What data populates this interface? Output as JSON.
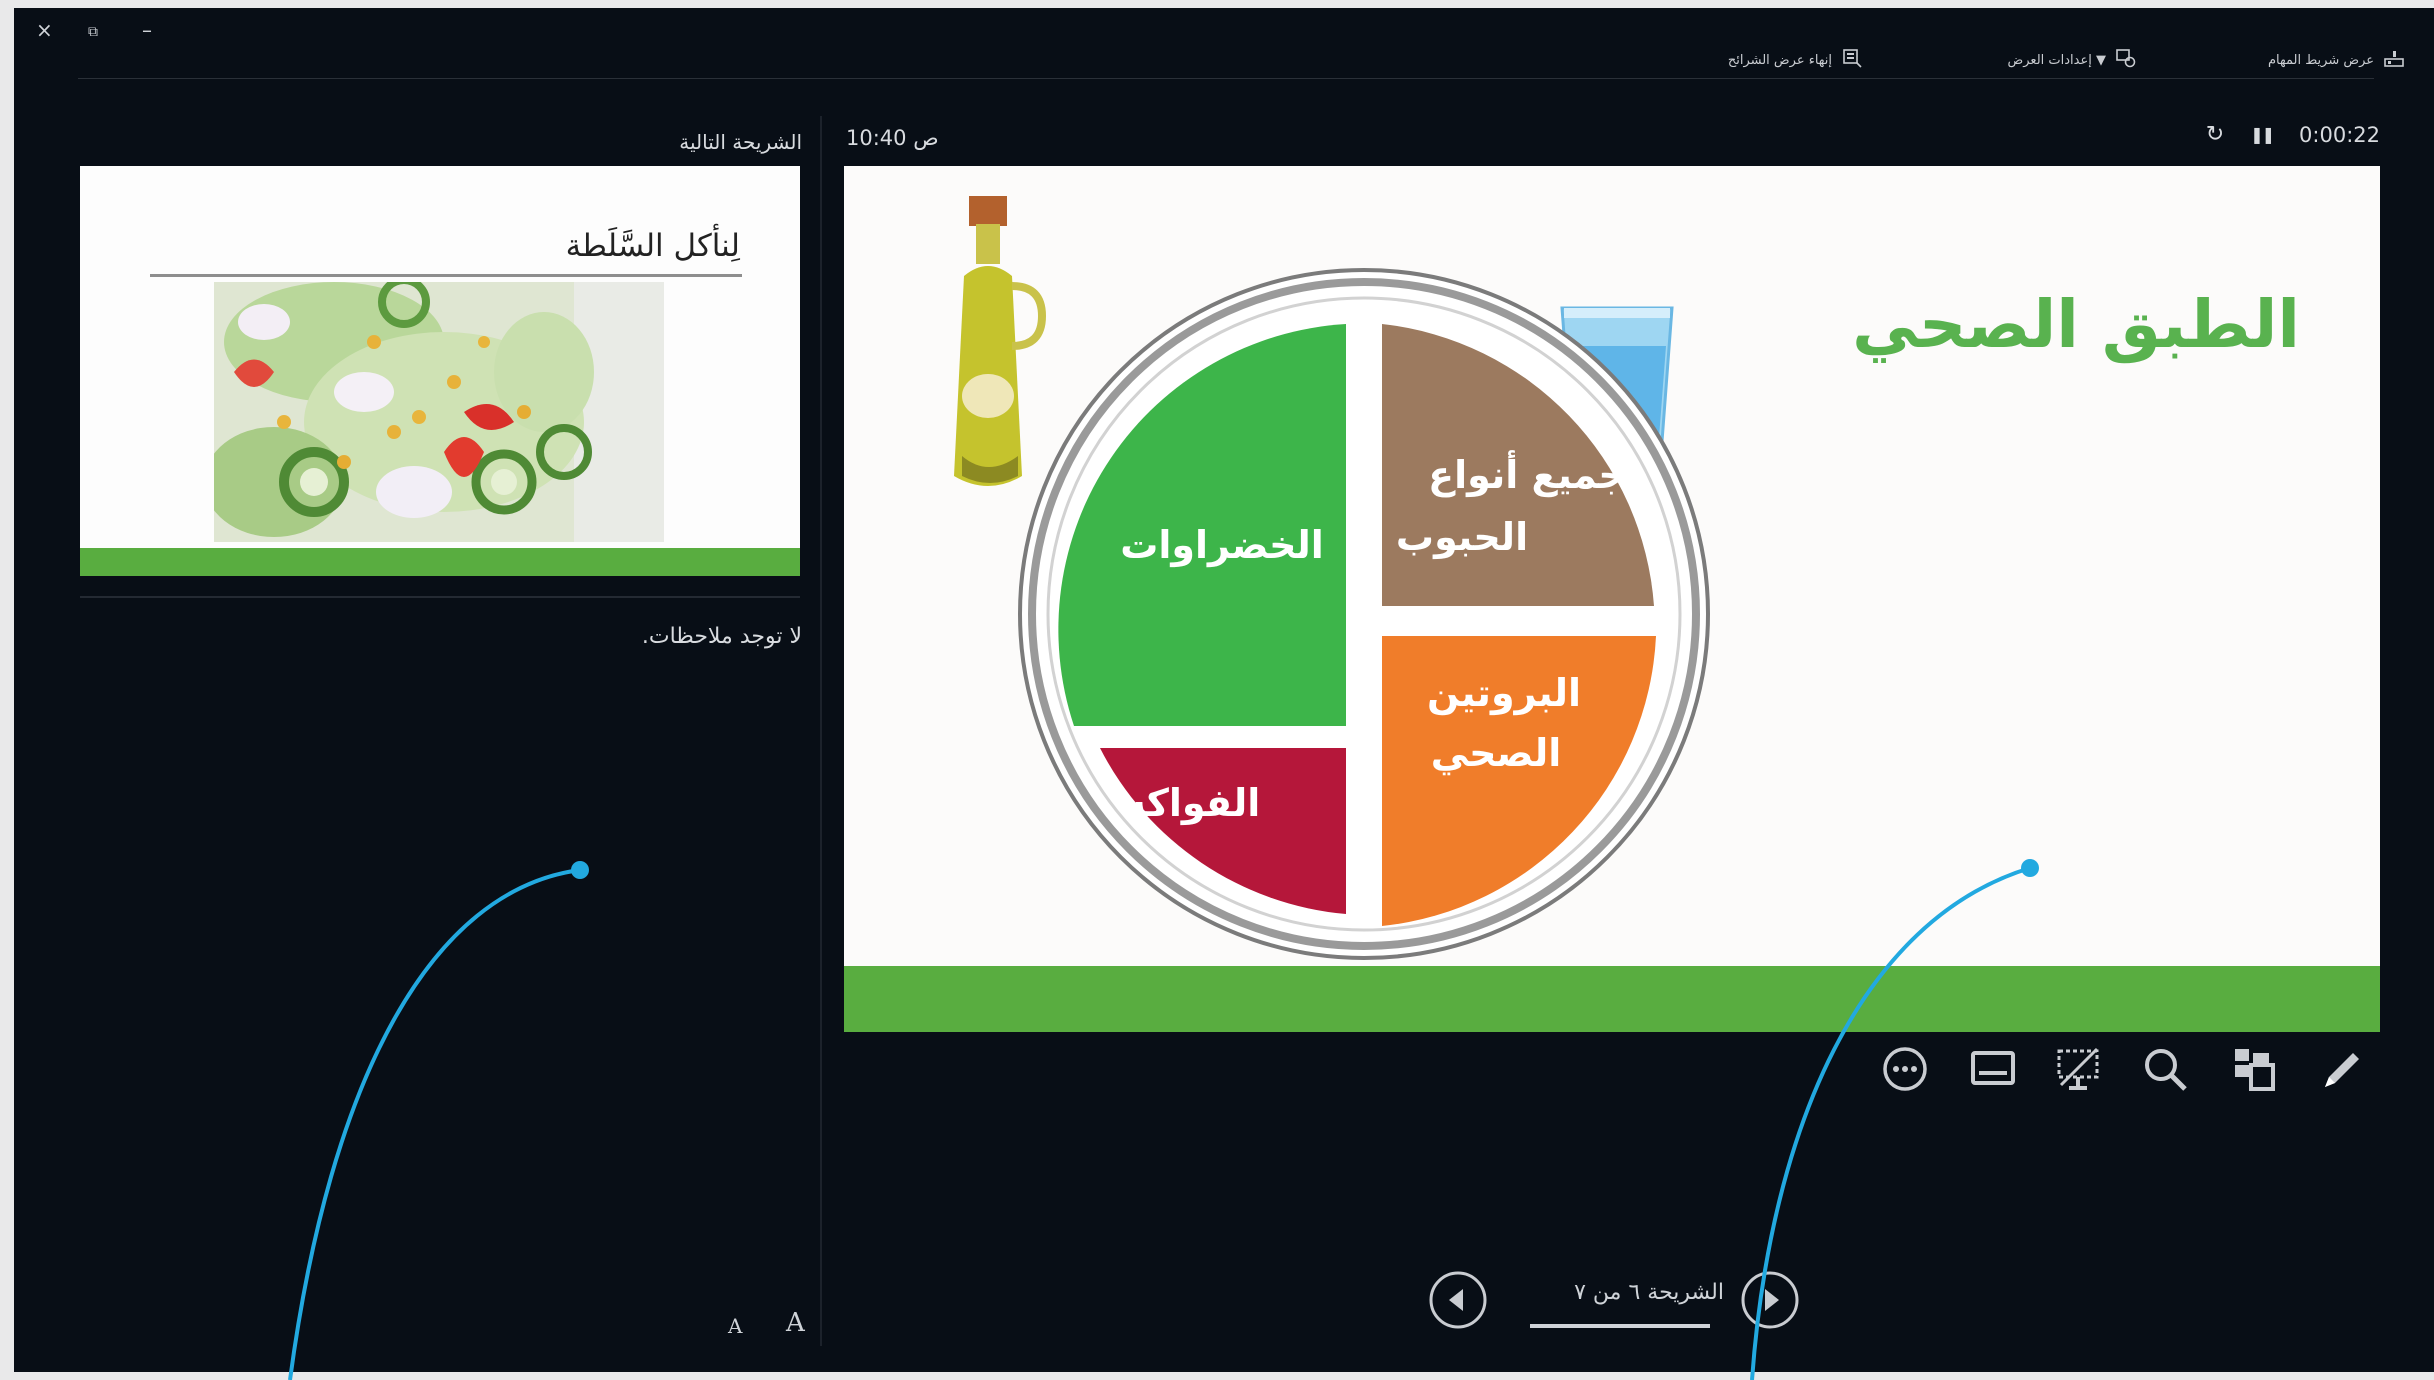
{
  "window": {
    "close_glyph": "×",
    "restore_glyph": "⧉",
    "minimize_glyph": "–"
  },
  "toolbar": {
    "show_taskbar": "عرض شريط المهام",
    "display_settings": "▼ إعدادات العرض",
    "end_show": "إنهاء عرض الشرائح"
  },
  "next_slide": {
    "header": "الشريحة التالية",
    "title": "لِنأكل السَّلَطة"
  },
  "notes": {
    "text": "لا توجد ملاحظات.",
    "increase_font": "A",
    "decrease_font": "A"
  },
  "current_slide": {
    "clock": "10:40 ص",
    "elapsed": "0:00:22",
    "title": "الطبق الصحي",
    "segments": {
      "vegetables": "الخضراوات",
      "grains_line1": "جميع أنواع",
      "grains_line2": "الحبوب",
      "protein_line1": "البروتين",
      "protein_line2": "الصحي",
      "fruits": "الفواكه"
    }
  },
  "tools": [
    "pen-icon",
    "slide-grid-icon",
    "zoom-icon",
    "black-screen-icon",
    "subtitles-icon",
    "more-options-icon"
  ],
  "nav": {
    "label": "الشريحة ٦ من ٧"
  },
  "colors": {
    "background": "#080e16",
    "accent_green": "#59ad40",
    "title_green": "#59b24f",
    "vegetables": "#3db54a",
    "grains": "#9c7a5f",
    "protein": "#f07d2a",
    "fruits": "#b5173a",
    "callout": "#22a9e0"
  }
}
